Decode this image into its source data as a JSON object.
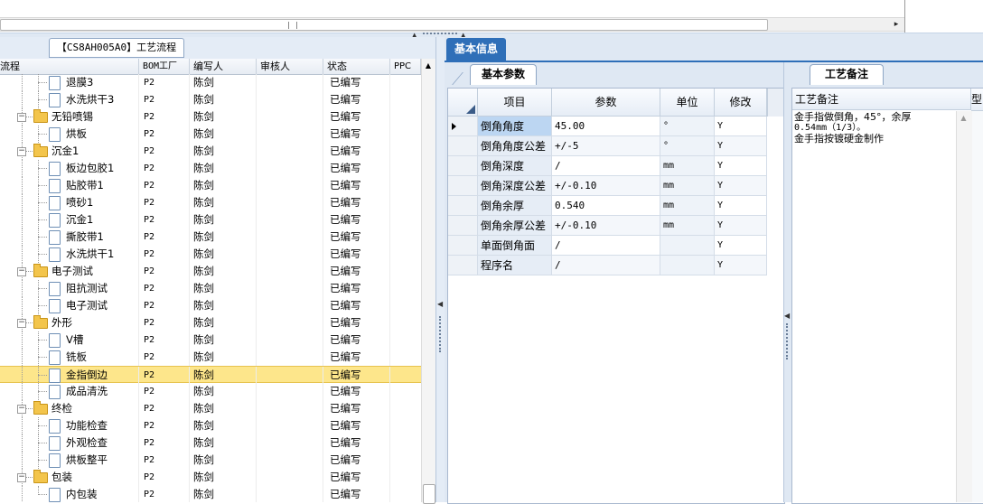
{
  "top": {
    "scroll_right_arrow": "▸"
  },
  "left": {
    "process_tab": "【CS8AH005A0】工艺流程",
    "columns": [
      "流程",
      "BOM工厂",
      "编写人",
      "审核人",
      "状态",
      "PPC"
    ],
    "rows": [
      {
        "level": 2,
        "type": "doc",
        "name": "退膜3",
        "bom": "P2",
        "writer": "陈剑",
        "reviewer": "",
        "status": "已编写"
      },
      {
        "level": 2,
        "type": "doc",
        "name": "水洗烘干3",
        "bom": "P2",
        "writer": "陈剑",
        "reviewer": "",
        "status": "已编写"
      },
      {
        "level": 1,
        "type": "folder",
        "name": "无铅喷锡",
        "bom": "P2",
        "writer": "陈剑",
        "reviewer": "",
        "status": "已编写"
      },
      {
        "level": 2,
        "type": "doc",
        "name": "烘板",
        "bom": "P2",
        "writer": "陈剑",
        "reviewer": "",
        "status": "已编写"
      },
      {
        "level": 1,
        "type": "folder",
        "name": "沉金1",
        "bom": "P2",
        "writer": "陈剑",
        "reviewer": "",
        "status": "已编写"
      },
      {
        "level": 2,
        "type": "doc",
        "name": "板边包胶1",
        "bom": "P2",
        "writer": "陈剑",
        "reviewer": "",
        "status": "已编写"
      },
      {
        "level": 2,
        "type": "doc",
        "name": "贴胶带1",
        "bom": "P2",
        "writer": "陈剑",
        "reviewer": "",
        "status": "已编写"
      },
      {
        "level": 2,
        "type": "doc",
        "name": "喷砂1",
        "bom": "P2",
        "writer": "陈剑",
        "reviewer": "",
        "status": "已编写"
      },
      {
        "level": 2,
        "type": "doc",
        "name": "沉金1",
        "bom": "P2",
        "writer": "陈剑",
        "reviewer": "",
        "status": "已编写"
      },
      {
        "level": 2,
        "type": "doc",
        "name": "撕胶带1",
        "bom": "P2",
        "writer": "陈剑",
        "reviewer": "",
        "status": "已编写"
      },
      {
        "level": 2,
        "type": "doc",
        "name": "水洗烘干1",
        "bom": "P2",
        "writer": "陈剑",
        "reviewer": "",
        "status": "已编写"
      },
      {
        "level": 1,
        "type": "folder",
        "name": "电子测试",
        "bom": "P2",
        "writer": "陈剑",
        "reviewer": "",
        "status": "已编写"
      },
      {
        "level": 2,
        "type": "doc",
        "name": "阻抗测试",
        "bom": "P2",
        "writer": "陈剑",
        "reviewer": "",
        "status": "已编写"
      },
      {
        "level": 2,
        "type": "doc",
        "name": "电子测试",
        "bom": "P2",
        "writer": "陈剑",
        "reviewer": "",
        "status": "已编写"
      },
      {
        "level": 1,
        "type": "folder",
        "name": "外形",
        "bom": "P2",
        "writer": "陈剑",
        "reviewer": "",
        "status": "已编写"
      },
      {
        "level": 2,
        "type": "doc",
        "name": "V槽",
        "bom": "P2",
        "writer": "陈剑",
        "reviewer": "",
        "status": "已编写"
      },
      {
        "level": 2,
        "type": "doc",
        "name": "铣板",
        "bom": "P2",
        "writer": "陈剑",
        "reviewer": "",
        "status": "已编写"
      },
      {
        "level": 2,
        "type": "doc",
        "name": "金指倒边",
        "bom": "P2",
        "writer": "陈剑",
        "reviewer": "",
        "status": "已编写",
        "selected": true
      },
      {
        "level": 2,
        "type": "doc",
        "name": "成品清洗",
        "bom": "P2",
        "writer": "陈剑",
        "reviewer": "",
        "status": "已编写"
      },
      {
        "level": 1,
        "type": "folder",
        "name": "终检",
        "bom": "P2",
        "writer": "陈剑",
        "reviewer": "",
        "status": "已编写"
      },
      {
        "level": 2,
        "type": "doc",
        "name": "功能检查",
        "bom": "P2",
        "writer": "陈剑",
        "reviewer": "",
        "status": "已编写"
      },
      {
        "level": 2,
        "type": "doc",
        "name": "外观检查",
        "bom": "P2",
        "writer": "陈剑",
        "reviewer": "",
        "status": "已编写"
      },
      {
        "level": 2,
        "type": "doc",
        "name": "烘板整平",
        "bom": "P2",
        "writer": "陈剑",
        "reviewer": "",
        "status": "已编写"
      },
      {
        "level": 1,
        "type": "folder",
        "name": "包装",
        "bom": "P2",
        "writer": "陈剑",
        "reviewer": "",
        "status": "已编写"
      },
      {
        "level": 2,
        "type": "doc",
        "name": "内包装",
        "bom": "P2",
        "writer": "陈剑",
        "reviewer": "",
        "status": "已编写"
      }
    ]
  },
  "right": {
    "main_tab": "基本信息",
    "params_tab": "基本参数",
    "notes_tab": "工艺备注",
    "grid_columns": [
      "项目",
      "参数",
      "单位",
      "修改"
    ],
    "grid_rows": [
      {
        "item": "倒角角度",
        "value": "45.00",
        "unit": "°",
        "modify": "Y",
        "current": true
      },
      {
        "item": "倒角角度公差",
        "value": "+/-5",
        "unit": "°",
        "modify": "Y"
      },
      {
        "item": "倒角深度",
        "value": "/",
        "unit": "mm",
        "modify": "Y"
      },
      {
        "item": "倒角深度公差",
        "value": "+/-0.10",
        "unit": "mm",
        "modify": "Y"
      },
      {
        "item": "倒角余厚",
        "value": "0.540",
        "unit": "mm",
        "modify": "Y"
      },
      {
        "item": "倒角余厚公差",
        "value": "+/-0.10",
        "unit": "mm",
        "modify": "Y"
      },
      {
        "item": "单面倒角面",
        "value": "/",
        "unit": "",
        "modify": "Y"
      },
      {
        "item": "程序名",
        "value": "/",
        "unit": "",
        "modify": "Y"
      }
    ],
    "notes_header": "工艺备注",
    "notes_header2": "型",
    "notes_lines": [
      "金手指做倒角，45°，余厚",
      "0.54mm（1/3）。",
      "金手指按镀硬金制作"
    ]
  }
}
